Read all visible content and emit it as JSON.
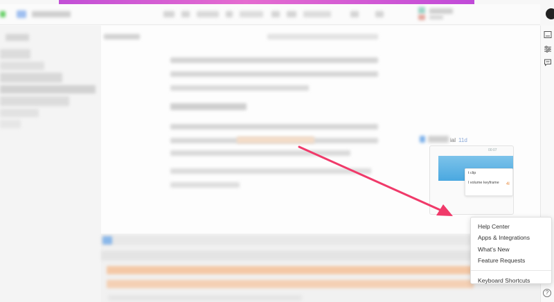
{
  "preview": {
    "comment_suffix": "ial",
    "comment_time": "11d",
    "time_code": "00:07",
    "menu_line1": "t clip",
    "menu_line2": "l volume keyframe",
    "orange_tag": "4l"
  },
  "help_menu": {
    "items": [
      "Help Center",
      "Apps & Integrations",
      "What's New",
      "Feature Requests"
    ],
    "footer_item": "Keyboard Shortcuts"
  },
  "rail": {
    "icons": [
      "panel-icon",
      "sliders-icon",
      "comment-icon",
      "help-icon"
    ],
    "help_glyph": "?"
  },
  "colors": {
    "accent_gradient_start": "#c24fd6",
    "accent_gradient_end": "#c04ad8",
    "arrow": "#f03a6a",
    "timeline_highlight": "#f6c9a4"
  }
}
